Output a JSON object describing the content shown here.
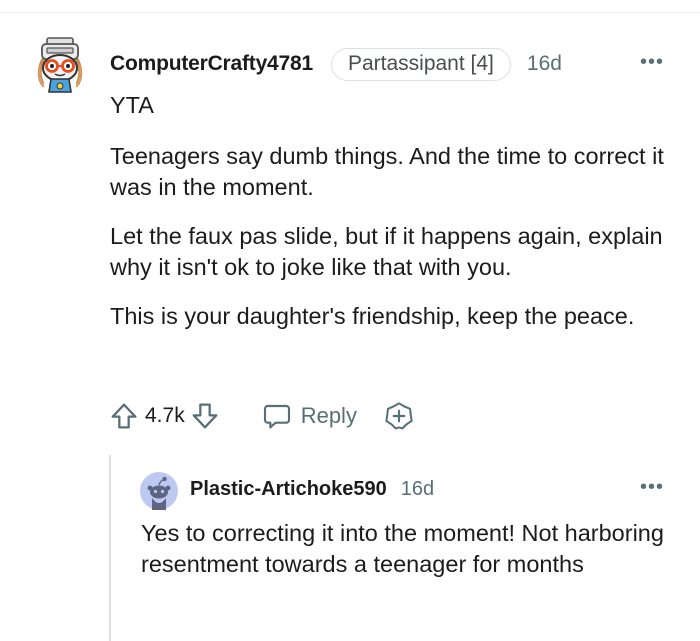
{
  "comment": {
    "username": "ComputerCrafty4781",
    "flair": "Partassipant [4]",
    "age": "16d",
    "more": "•••",
    "paragraphs": [
      "YTA",
      "Teenagers say dumb things. And the time to correct it was in the moment.",
      "Let the faux pas slide, but if it happens again, explain why it isn't ok to joke like that with you.",
      "This is your daughter's friendship, keep the peace."
    ],
    "score": "4.7k",
    "reply_label": "Reply",
    "icons": [
      "upvote-icon",
      "downvote-icon",
      "reply-bubble-icon",
      "award-plus-icon"
    ]
  },
  "reply": {
    "username": "Plastic-Artichoke590",
    "age": "16d",
    "more": "•••",
    "text": "Yes to correcting it into the moment! Not harboring resentment towards a teenager for months"
  },
  "colors": {
    "text": "#1c1c1c",
    "muted": "#576f76",
    "border": "#dcdfe3",
    "reply_avatar_bg": "#bdc9f2",
    "snoo": "#5d6580"
  }
}
